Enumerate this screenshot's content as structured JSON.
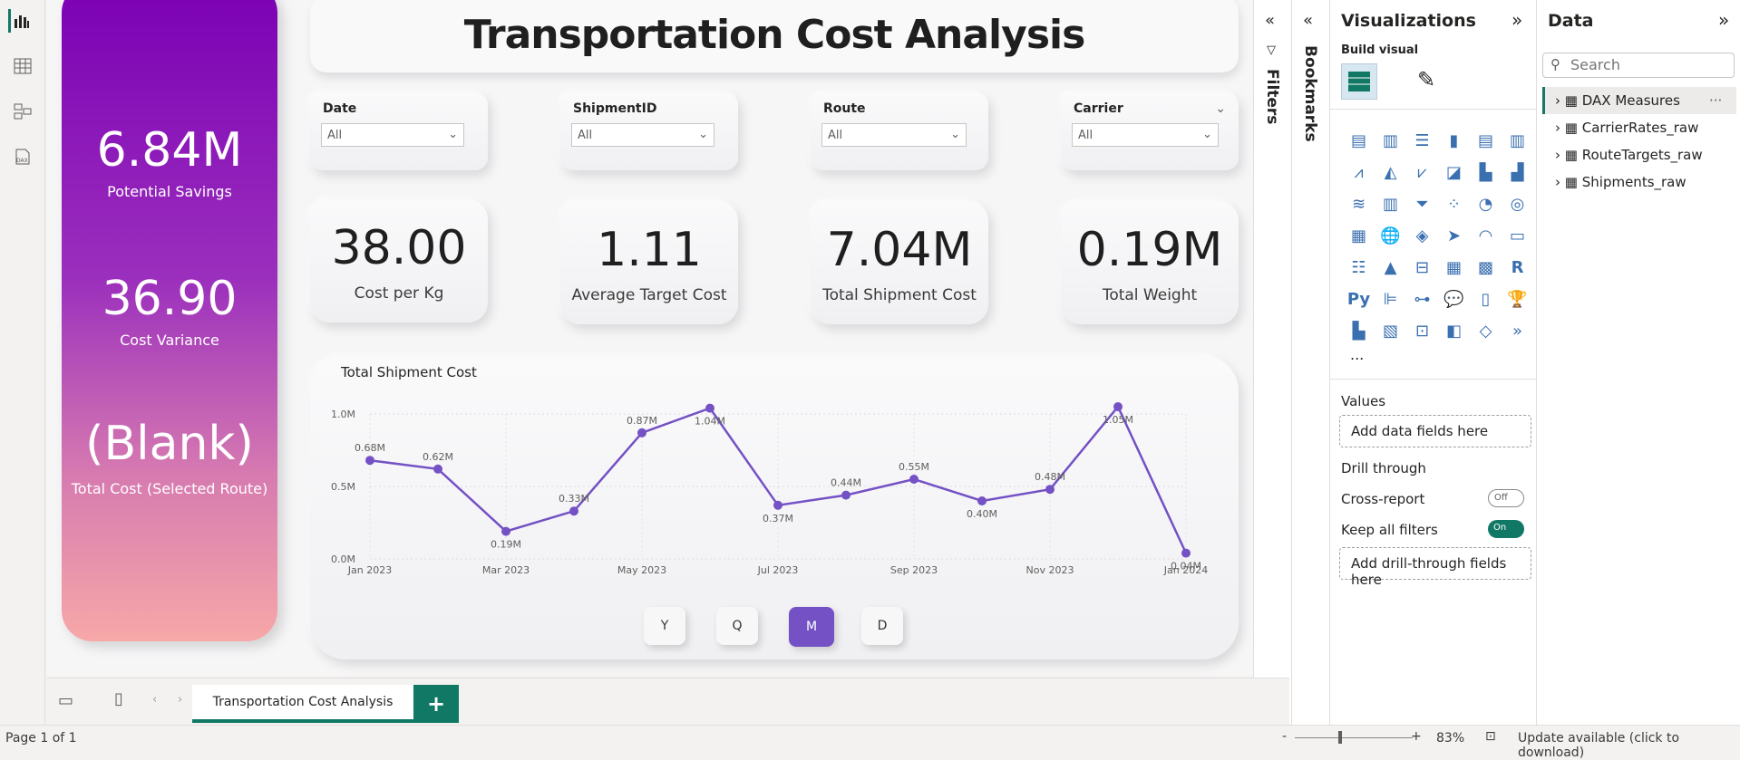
{
  "left_rail": {
    "icons": [
      "report-view-icon",
      "table-view-icon",
      "model-view-icon",
      "dax-query-icon"
    ]
  },
  "title": "Transportation Cost Analysis",
  "hero": {
    "items": [
      {
        "value": "6.84M",
        "label": "Potential Savings"
      },
      {
        "value": "36.90",
        "label": "Cost Variance"
      },
      {
        "value": "(Blank)",
        "label": "Total Cost (Selected Route)"
      }
    ]
  },
  "slicers": [
    {
      "title": "Date",
      "value": "All"
    },
    {
      "title": "ShipmentID",
      "value": "All"
    },
    {
      "title": "Route",
      "value": "All"
    },
    {
      "title": "Carrier",
      "value": "All"
    }
  ],
  "kpis": [
    {
      "value": "38.00",
      "label": "Cost per Kg"
    },
    {
      "value": "1.11",
      "label": "Average Target Cost"
    },
    {
      "value": "7.04M",
      "label": "Total Shipment Cost"
    },
    {
      "value": "0.19M",
      "label": "Total Weight"
    }
  ],
  "chart_data": {
    "type": "line",
    "title": "Total Shipment Cost",
    "x": [
      "Jan 2023",
      "Feb 2023",
      "Mar 2023",
      "Apr 2023",
      "May 2023",
      "Jun 2023",
      "Jul 2023",
      "Aug 2023",
      "Sep 2023",
      "Oct 2023",
      "Nov 2023",
      "Dec 2023",
      "Jan 2024"
    ],
    "xticks": [
      "Jan 2023",
      "Mar 2023",
      "May 2023",
      "Jul 2023",
      "Sep 2023",
      "Nov 2023",
      "Jan 2024"
    ],
    "values": [
      0.68,
      0.62,
      0.19,
      0.33,
      0.87,
      1.04,
      0.37,
      0.44,
      0.55,
      0.4,
      0.48,
      1.05,
      0.04
    ],
    "labels": [
      "0.68M",
      "0.62M",
      "0.19M",
      "0.33M",
      "0.87M",
      "1.04M",
      "0.37M",
      "0.44M",
      "0.55M",
      "0.40M",
      "0.48M",
      "1.05M",
      "0.04M"
    ],
    "yticks": [
      "0.0M",
      "0.5M",
      "1.0M"
    ],
    "ylim": [
      0,
      1.0
    ],
    "color": "#7451c4",
    "grid": true
  },
  "granularity": {
    "buttons": [
      "Y",
      "Q",
      "M",
      "D"
    ],
    "selected": "M"
  },
  "filters_label": "Filters",
  "bookmarks_label": "Bookmarks",
  "visualizations": {
    "title": "Visualizations",
    "build_visual": "Build visual",
    "values_label": "Values",
    "add_data": "Add data fields here",
    "drill_through": "Drill through",
    "cross_report": "Cross-report",
    "cross_report_state": "Off",
    "keep_filters": "Keep all filters",
    "keep_filters_state": "On",
    "add_drill": "Add drill-through fields here",
    "more": "..."
  },
  "data_pane": {
    "title": "Data",
    "search_placeholder": "Search",
    "items": [
      "DAX Measures",
      "CarrierRates_raw",
      "RouteTargets_raw",
      "Shipments_raw"
    ]
  },
  "pages": {
    "tab": "Transportation Cost Analysis",
    "add": "+"
  },
  "status": {
    "page": "Page 1 of 1",
    "zoom": "83%",
    "update": "Update available (click to download)"
  }
}
